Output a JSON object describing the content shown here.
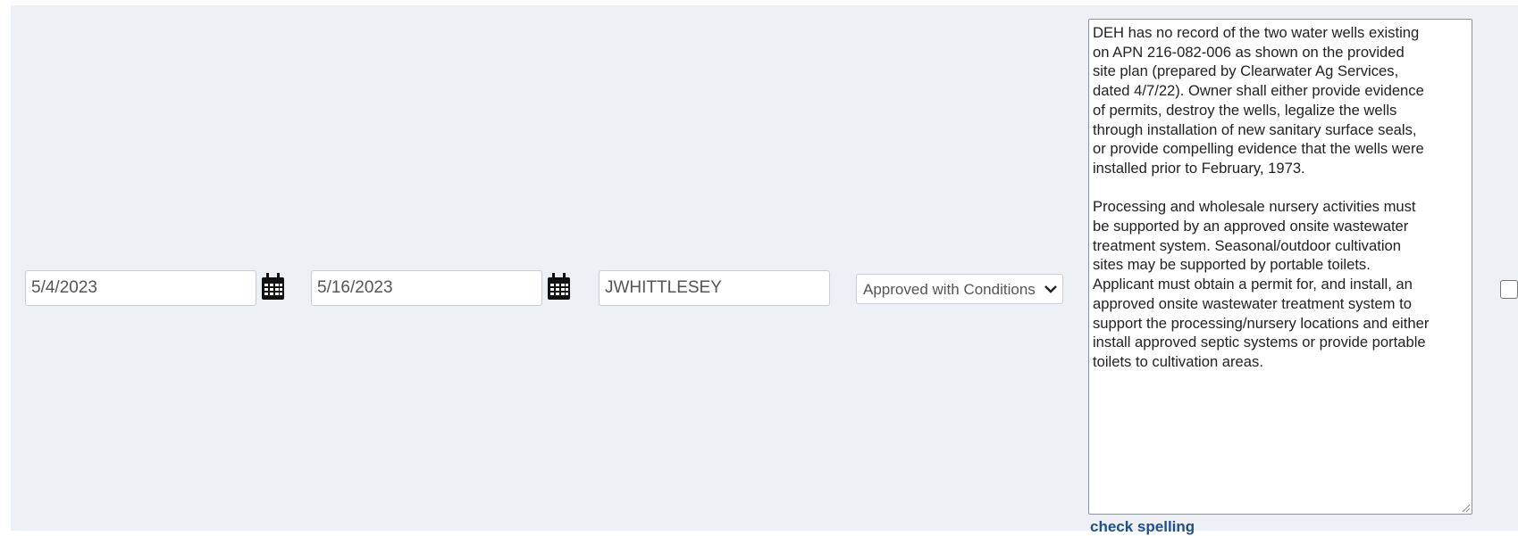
{
  "row": {
    "start_date": {
      "value": "5/4/2023",
      "icon": "calendar-icon"
    },
    "end_date": {
      "value": "5/16/2023",
      "icon": "calendar-icon"
    },
    "reviewer": {
      "value": "JWHITTLESEY"
    },
    "status": {
      "selected": "Approved with Conditions",
      "icon": "chevron-down-icon"
    },
    "comments": {
      "text": "DEH has no record of the two water wells existing\non APN 216-082-006 as shown on the provided\nsite plan (prepared by Clearwater Ag Services,\ndated 4/7/22). Owner shall either provide evidence\nof permits, destroy the wells, legalize the wells\nthrough installation of new sanitary surface seals,\nor provide compelling evidence that the wells were\ninstalled prior to February, 1973.\n\nProcessing and wholesale nursery activities must\nbe supported by an approved onsite wastewater\ntreatment system. Seasonal/outdoor cultivation\nsites may be supported by portable toilets.\nApplicant must obtain a permit for, and install, an\napproved onsite wastewater treatment system to\nsupport the processing/nursery locations and either\ninstall approved septic systems or provide portable\ntoilets to cultivation areas.",
      "check_spelling_label": "check spelling"
    },
    "checkbox_checked": false
  }
}
